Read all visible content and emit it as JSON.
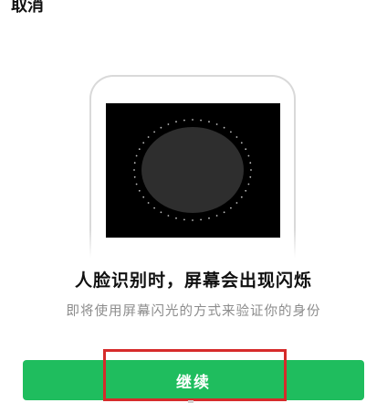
{
  "header": {
    "cancel_label": "取消"
  },
  "main": {
    "headline": "人脸识别时，屏幕会出现闪烁",
    "subline": "即将使用屏幕闪光的方式来验证你的身份"
  },
  "footer": {
    "continue_label": "继续"
  },
  "colors": {
    "primary_button": "#1fbd5e",
    "highlight_box": "#d62b2b",
    "screen_bg": "#000000",
    "face_oval": "#2e2e2e"
  }
}
